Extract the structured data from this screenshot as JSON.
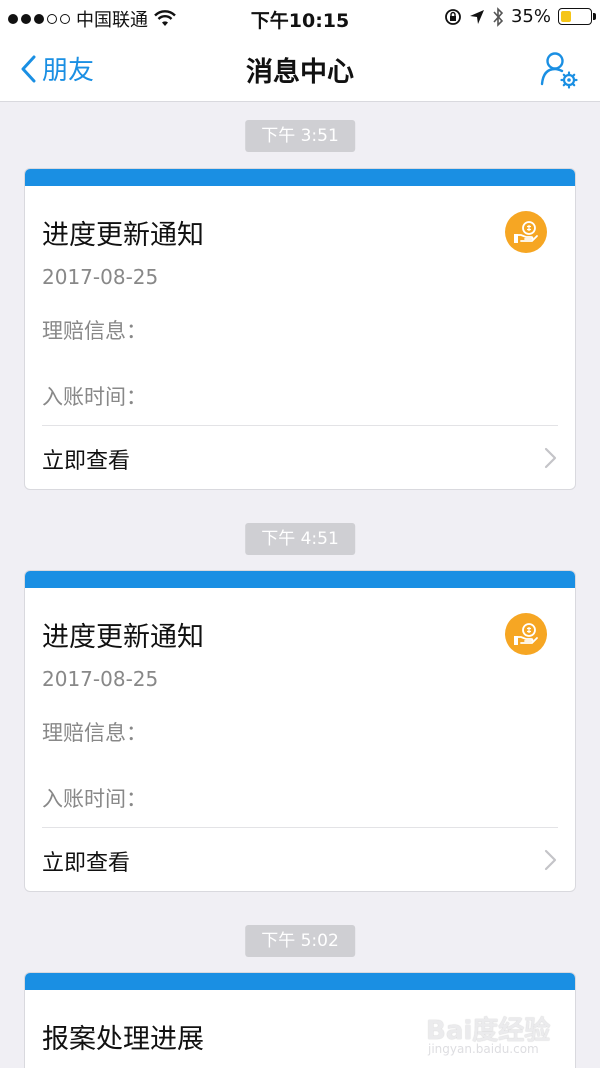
{
  "status_bar": {
    "carrier": "中国联通",
    "time": "下午10:15",
    "battery": "35%",
    "battery_level": 0.35,
    "icons": [
      "signal-dots",
      "wifi-icon",
      "rotation-lock-icon",
      "location-arrow-icon",
      "bluetooth-icon",
      "battery-icon"
    ]
  },
  "nav": {
    "back_label": "朋友",
    "title": "消息中心",
    "settings_icon": "user-settings-icon"
  },
  "colors": {
    "accent": "#1a8fe3",
    "badge": "#f6a623",
    "background": "#f0eff4",
    "timestamp_bg": "#cfcfd3"
  },
  "messages": [
    {
      "time": "下午 3:51",
      "title": "进度更新通知",
      "date": "2017-08-25",
      "field1": "理赔信息：",
      "field2": "入账时间：",
      "action": "立即查看",
      "badge_icon": "hand-coin-icon"
    },
    {
      "time": "下午 4:51",
      "title": "进度更新通知",
      "date": "2017-08-25",
      "field1": "理赔信息：",
      "field2": "入账时间：",
      "action": "立即查看",
      "badge_icon": "hand-coin-icon"
    },
    {
      "time": "下午 5:02",
      "title": "报案处理进展"
    }
  ],
  "watermark": {
    "text": "Bai度经验",
    "sub": "jingyan.baidu.com"
  }
}
